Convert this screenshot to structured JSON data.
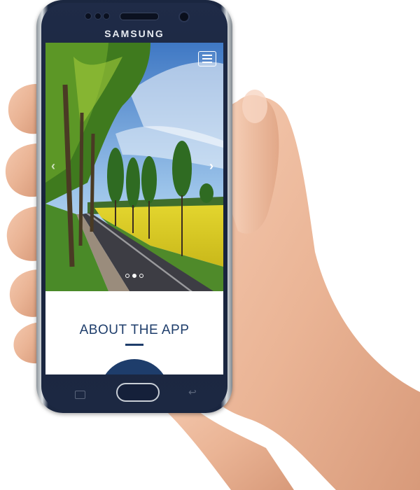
{
  "device": {
    "brand": "SAMSUNG"
  },
  "app": {
    "carousel": {
      "slide_count": 3,
      "active_slide": 2,
      "prev_arrow": "‹",
      "next_arrow": "›"
    },
    "menu_icon": "hamburger-icon",
    "section_title": "ABOUT THE APP",
    "accent_color": "#1e3d6b"
  },
  "nav": {
    "back_glyph": "↩"
  }
}
